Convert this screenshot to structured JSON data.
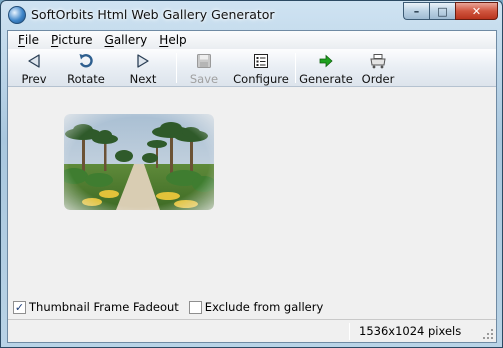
{
  "window": {
    "title": "SoftOrbits Html Web Gallery Generator",
    "controls": {
      "minimize": "–",
      "maximize": "□",
      "close": "✕"
    }
  },
  "menu": [
    {
      "first": "F",
      "rest": "ile"
    },
    {
      "first": "P",
      "rest": "icture"
    },
    {
      "first": "G",
      "rest": "allery"
    },
    {
      "first": "H",
      "rest": "elp"
    }
  ],
  "toolbar": {
    "prev_label": "Prev",
    "rotate_label": "Rotate",
    "next_label": "Next",
    "save_label": "Save",
    "configure_label": "Configure",
    "generate_label": "Generate",
    "order_label": "Order"
  },
  "options": {
    "thumbnail_fadeout_label": "Thumbnail Frame Fadeout",
    "thumbnail_fadeout_checked": true,
    "exclude_label": "Exclude from gallery",
    "exclude_checked": false
  },
  "status": {
    "dimensions": "1536x1024 pixels"
  },
  "icons": {
    "prev": "triangle-left-icon",
    "rotate": "rotate-icon",
    "next": "triangle-right-icon",
    "save": "floppy-disk-icon",
    "configure": "list-settings-icon",
    "generate": "green-arrow-icon",
    "order": "printer-cart-icon"
  },
  "colors": {
    "generate_arrow": "#1fa21f",
    "checkmark": "#1b3c78",
    "close_button": "#c8442b"
  }
}
